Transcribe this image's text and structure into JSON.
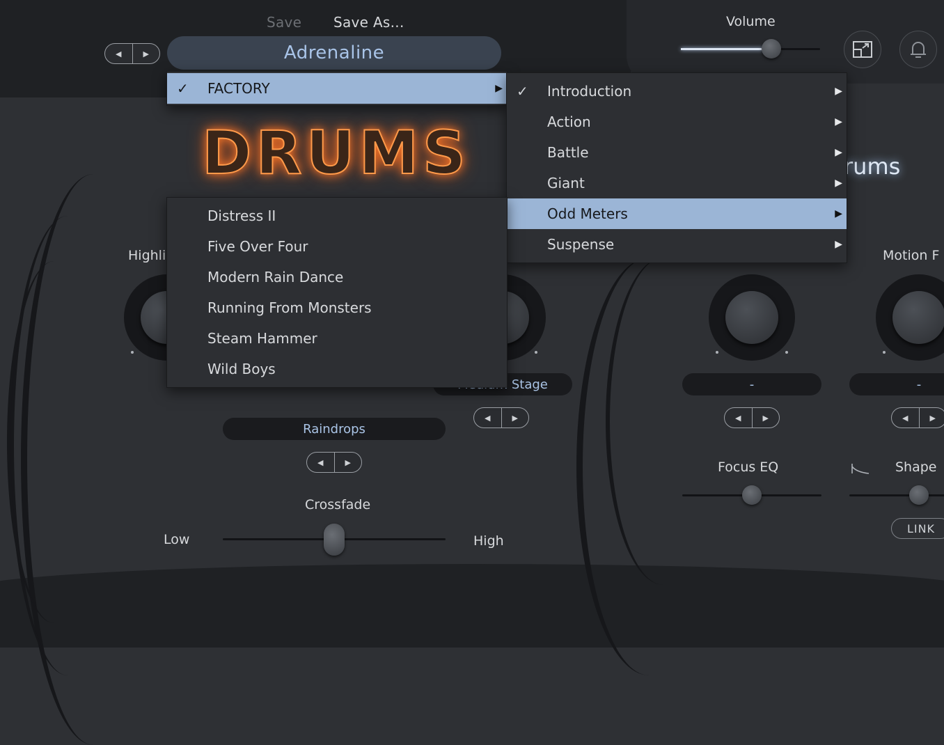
{
  "header": {
    "save_label": "Save",
    "save_as_label": "Save As...",
    "preset_name": "Adrenaline",
    "volume_label": "Volume",
    "volume_level": 0.65
  },
  "title": {
    "drums": "DRUMS",
    "drums_right": "rums"
  },
  "controls": {
    "highlight_label": "Highli",
    "motion_label": "Motion F",
    "raindrops_value": "Raindrops",
    "stage_value": "Medium Stage",
    "knob3_value": "-",
    "knob4_value": "-",
    "crossfade_label": "Crossfade",
    "crossfade_low": "Low",
    "crossfade_high": "High",
    "focus_eq_label": "Focus EQ",
    "shape_label": "Shape",
    "link_label": "LINK"
  },
  "menu_root": {
    "items": [
      {
        "label": "FACTORY",
        "checked": true,
        "has_submenu": true
      }
    ]
  },
  "menu_categories": {
    "items": [
      {
        "label": "Introduction",
        "checked": true
      },
      {
        "label": "Action"
      },
      {
        "label": "Battle"
      },
      {
        "label": "Giant"
      },
      {
        "label": "Odd Meters",
        "highlighted": true
      },
      {
        "label": "Suspense"
      }
    ]
  },
  "menu_presets": {
    "items": [
      {
        "label": "Distress II"
      },
      {
        "label": "Five Over Four"
      },
      {
        "label": "Modern Rain Dance"
      },
      {
        "label": "Running From Monsters"
      },
      {
        "label": "Steam Hammer"
      },
      {
        "label": "Wild Boys"
      }
    ]
  },
  "glyphs": {
    "check": "✓",
    "submenu": "▶",
    "prev": "◀",
    "next": "▶"
  }
}
